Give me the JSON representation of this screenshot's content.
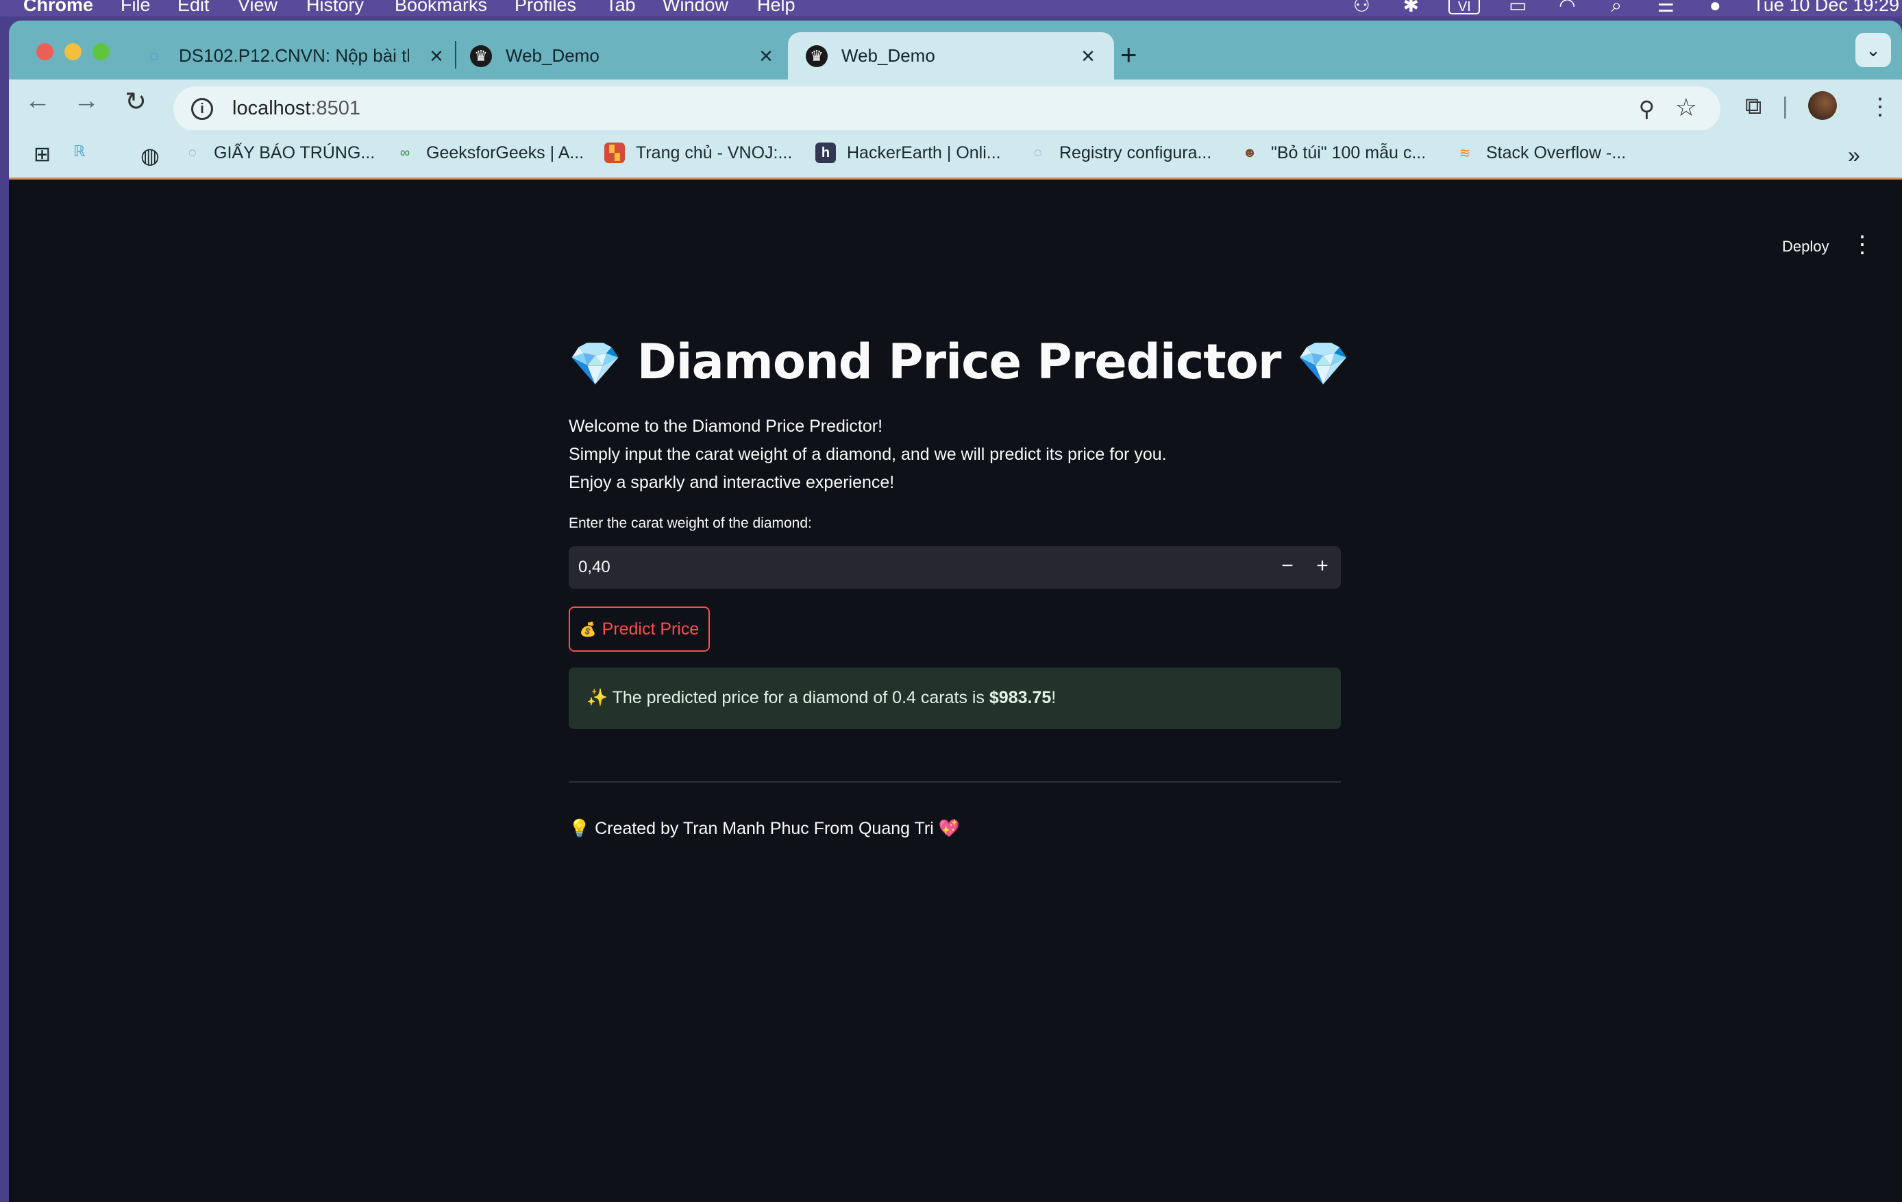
{
  "menubar": {
    "app": "Chrome",
    "items": [
      "File",
      "Edit",
      "View",
      "History",
      "Bookmarks",
      "Profiles",
      "Tab",
      "Window",
      "Help"
    ],
    "input_source": "VI",
    "datetime": "Tue 10 Dec  19:29"
  },
  "tabs": [
    {
      "title": "DS102.P12.CNVN: Nộp bài th",
      "close": "×"
    },
    {
      "title": "Web_Demo",
      "close": "×"
    },
    {
      "title": "Web_Demo",
      "close": "×"
    }
  ],
  "newtab": "+",
  "toolbar": {
    "url_host": "localhost",
    "url_port": ":8501"
  },
  "bookmarks": [
    {
      "label": "GIẤY BÁO TRÚNG..."
    },
    {
      "label": "GeeksforGeeks | A..."
    },
    {
      "label": "Trang chủ - VNOJ:..."
    },
    {
      "label": "HackerEarth | Onli..."
    },
    {
      "label": "Registry configura..."
    },
    {
      "label": "\"Bỏ túi\" 100 mẫu c..."
    },
    {
      "label": "Stack Overflow -..."
    }
  ],
  "app": {
    "deploy": "Deploy",
    "title": "Diamond Price Predictor",
    "gem": "💎",
    "intro": [
      "Welcome to the Diamond Price Predictor!",
      "Simply input the carat weight of a diamond, and we will predict its price for you.",
      "Enjoy a sparkly and interactive experience!"
    ],
    "input_label": "Enter the carat weight of the diamond:",
    "input_value": "0,40",
    "minus": "−",
    "plus": "+",
    "button_icon": "💰",
    "button_label": "Predict Price",
    "result_prefix": "✨ The predicted price for a diamond of 0.4 carats is ",
    "result_price": "$983.75",
    "result_suffix": "!",
    "footer_icon": "💡",
    "footer_text": " Created by Tran Manh Phuc From Quang Tri ",
    "footer_heart": "💖"
  }
}
